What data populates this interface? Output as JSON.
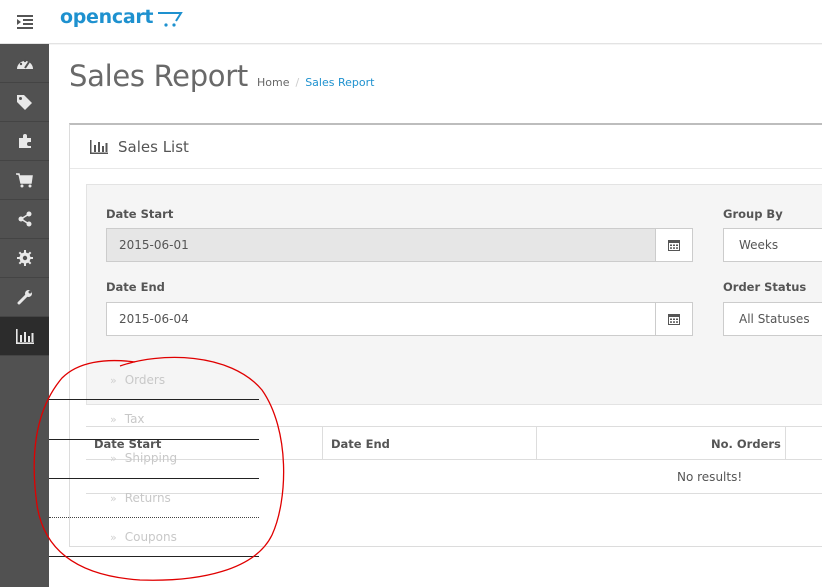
{
  "header": {
    "logo_text": "opencart",
    "menu_icon": "indent-icon",
    "cart_icon": "cart-logo-icon"
  },
  "sidebar": {
    "items": [
      {
        "icon": "dashboard-icon"
      },
      {
        "icon": "tags-icon"
      },
      {
        "icon": "puzzle-icon"
      },
      {
        "icon": "shopping-cart-icon"
      },
      {
        "icon": "share-icon"
      },
      {
        "icon": "gear-icon"
      },
      {
        "icon": "wrench-icon"
      },
      {
        "icon": "bar-chart-icon",
        "active": true
      }
    ]
  },
  "page": {
    "title": "Sales Report",
    "breadcrumb": {
      "home": "Home",
      "separator": "/",
      "current": "Sales Report"
    }
  },
  "panel": {
    "title": "Sales List",
    "icon": "bar-chart-icon"
  },
  "filters": {
    "date_start_label": "Date Start",
    "date_start_value": "2015-06-01",
    "date_end_label": "Date End",
    "date_end_value": "2015-06-04",
    "group_by_label": "Group By",
    "group_by_value": "Weeks",
    "order_status_label": "Order Status",
    "order_status_value": "All Statuses"
  },
  "table": {
    "columns": [
      "Date Start",
      "Date End",
      "No. Orders"
    ],
    "empty_text": "No results!"
  },
  "dropdown_menu": {
    "items": [
      "Orders",
      "Tax",
      "Shipping",
      "Returns",
      "Coupons"
    ]
  },
  "colors": {
    "accent": "#1e91cf",
    "sidebar_bg": "#515151",
    "sidebar_active": "#2c2c2c",
    "annotation": "#e00000"
  }
}
